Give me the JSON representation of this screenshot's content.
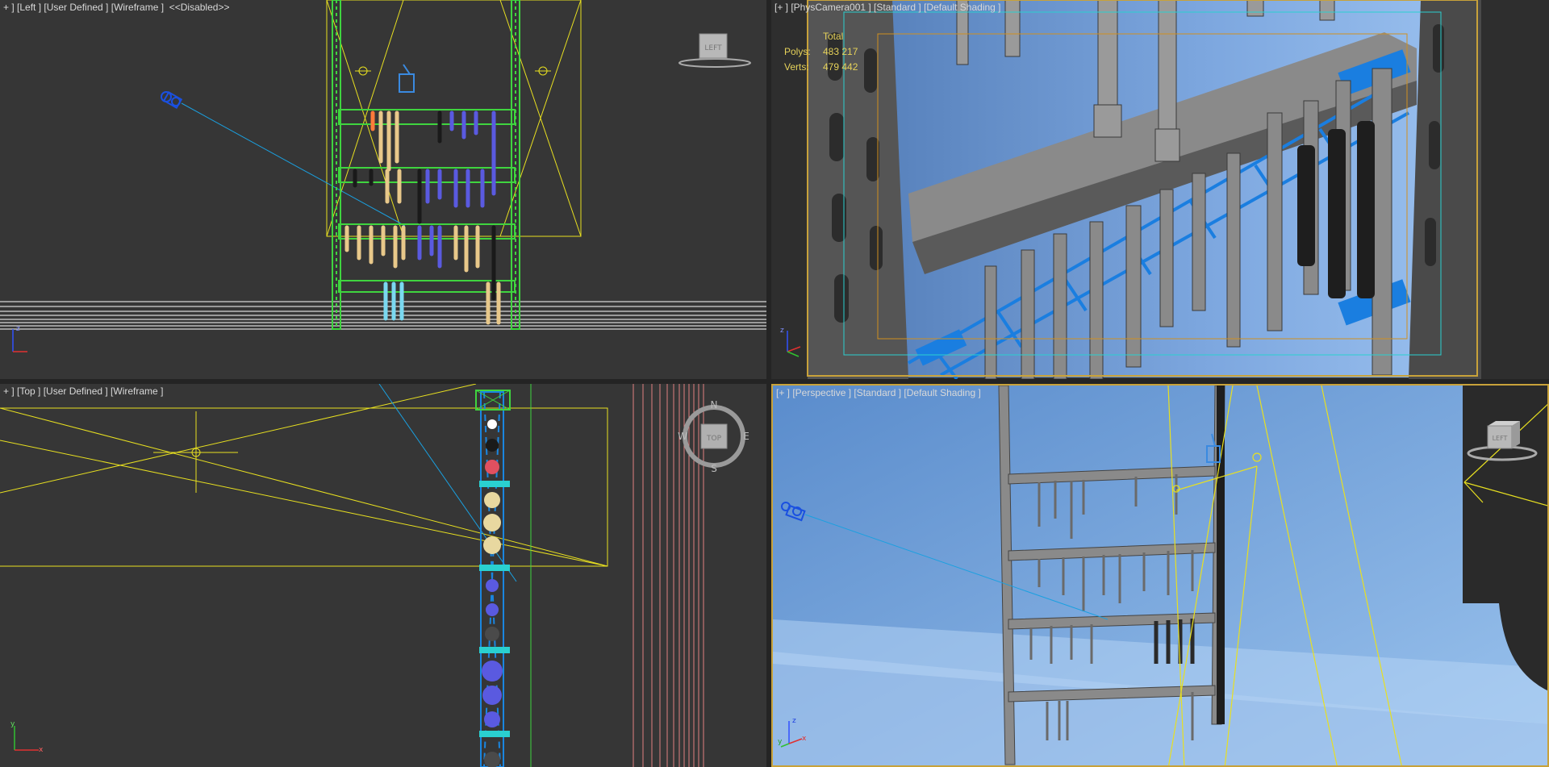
{
  "viewports": {
    "left": {
      "label": "+ ] [Left ] [User Defined ] [Wireframe ]  <<Disabled>>",
      "viewcube_face": "LEFT"
    },
    "camera": {
      "label": "[+ ] [PhysCamera001 ] [Standard ] [Default Shading ]",
      "stats": {
        "header": "Total",
        "polys_label": "Polys:",
        "polys_value": "483 217",
        "verts_label": "Verts:",
        "verts_value": "479 442"
      }
    },
    "top": {
      "label": "+ ] [Top ] [User Defined ] [Wireframe ]",
      "compass": {
        "center": "TOP",
        "n": "N",
        "s": "S",
        "e": "E",
        "w": "W"
      }
    },
    "perspective": {
      "label": "[+ ] [Perspective ] [Standard ] [Default Shading ]",
      "viewcube_face": "LEFT"
    }
  },
  "axes": {
    "x": "x",
    "y": "y",
    "z": "z"
  },
  "icons": [
    "viewcube-icon",
    "compass-icon",
    "camera-icon",
    "axis-tripod-icon"
  ],
  "colors": {
    "rack_green": "#3fd43f",
    "light_yellow": "#e8e020",
    "camera_blue": "#1a86e0",
    "grid_white": "#ffffff",
    "active_border": "#c8a23a",
    "bolt_blue": "#5a5ae0",
    "bolt_tan": "#e8c88a"
  }
}
